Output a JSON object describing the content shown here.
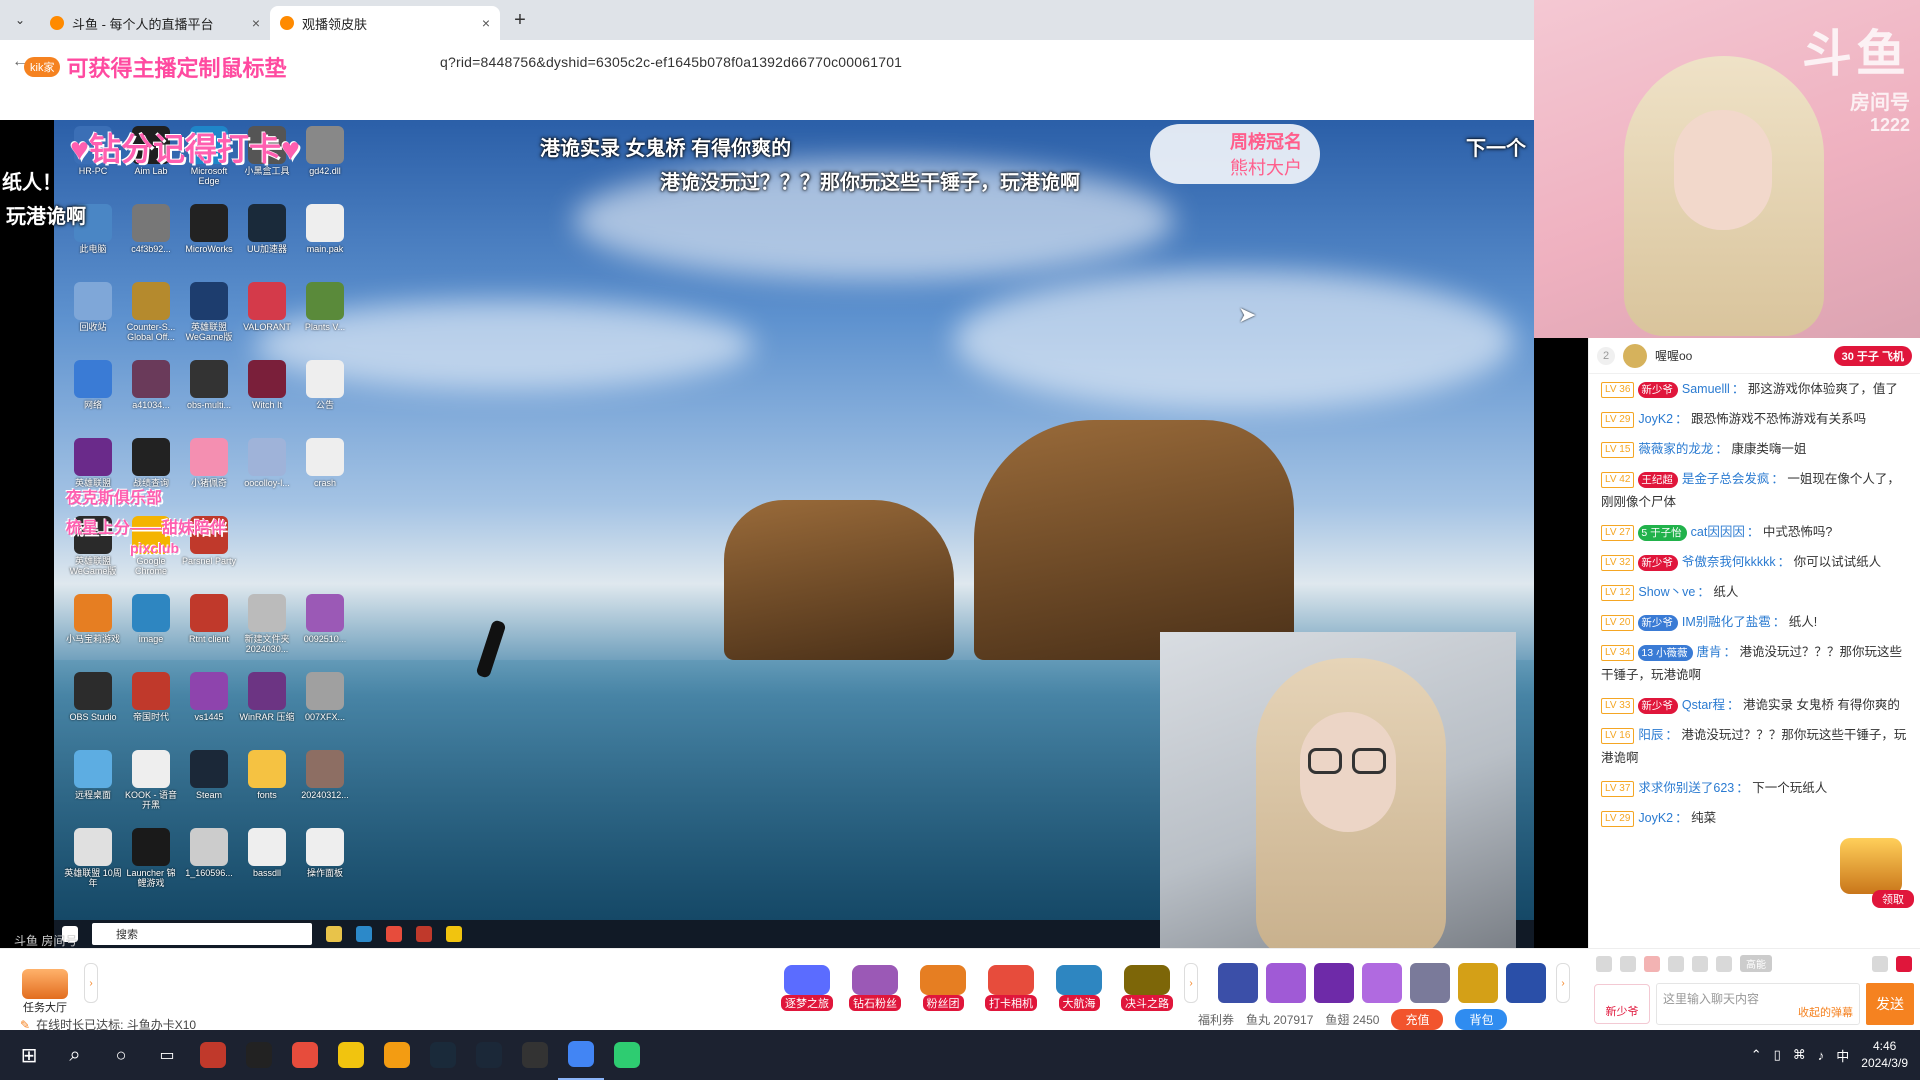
{
  "browser": {
    "tabs": [
      {
        "title": "斗鱼 - 每个人的直播平台",
        "active": false
      },
      {
        "title": "观播领皮肤",
        "active": true
      }
    ],
    "new_tab": "+",
    "close": "×",
    "url": "q?rid=8448756&dyshid=6305c2c-ef1645b078f0a1392d66770c00061701"
  },
  "promo": {
    "badge": "kik家",
    "text": "可获得主播定制鼠标垫"
  },
  "overlay": {
    "diamond_text": "♥钻分记得打卡♥",
    "line1": "港诡实录 女鬼桥 有得你爽的",
    "line2": "港诡没玩过？？？那你玩这些干锤子，玩港诡啊",
    "left_line1": "纸人！",
    "left_line2": "玩港诡啊",
    "right_cut": "下一个",
    "weekly_title": "周榜冠名",
    "weekly_name": "熊村大户",
    "club_text": "夜克斯俱乐部",
    "ranking_text": "梳星上分——甜妹陪伴",
    "pixclub": "pixclub",
    "watermark": "斗鱼 房间号",
    "search": "搜索"
  },
  "desktop_icons": [
    {
      "label": "HR-PC",
      "color": "#3b6fb6"
    },
    {
      "label": "Aim Lab",
      "color": "#1f1f1f"
    },
    {
      "label": "Microsoft Edge",
      "color": "#1f86c9"
    },
    {
      "label": "小黑盒工具",
      "color": "#555"
    },
    {
      "label": "gd42.dll",
      "color": "#888"
    },
    {
      "label": "此电脑",
      "color": "#4a86c5"
    },
    {
      "label": "c4f3b92...",
      "color": "#777"
    },
    {
      "label": "MicroWorks",
      "color": "#222"
    },
    {
      "label": "UU加速器",
      "color": "#1a2a3a"
    },
    {
      "label": "main.pak",
      "color": "#eee"
    },
    {
      "label": "回收站",
      "color": "#7fa7d8"
    },
    {
      "label": "Counter-S... Global Off...",
      "color": "#b58a2d"
    },
    {
      "label": "英雄联盟 WeGame版",
      "color": "#1d3d6e"
    },
    {
      "label": "VALORANT",
      "color": "#d43a4a"
    },
    {
      "label": "Plants V...",
      "color": "#5a8a3a"
    },
    {
      "label": "网络",
      "color": "#3a7bd5"
    },
    {
      "label": "a41034...",
      "color": "#6a3a5a"
    },
    {
      "label": "obs-multi...",
      "color": "#333"
    },
    {
      "label": "Witch It",
      "color": "#7a1f3a"
    },
    {
      "label": "公告",
      "color": "#eee"
    },
    {
      "label": "英雄联盟",
      "color": "#6a2a8a"
    },
    {
      "label": "战绩查询",
      "color": "#222"
    },
    {
      "label": "小猪佩奇",
      "color": "#f48fb1"
    },
    {
      "label": "oocolloy-l...",
      "color": "#9fb3d9"
    },
    {
      "label": "crash",
      "color": "#eee"
    },
    {
      "label": "英雄联盟 WeGame版",
      "color": "#2a2a2a"
    },
    {
      "label": "Google Chrome",
      "color": "#f4b400"
    },
    {
      "label": "Parsnel Party",
      "color": "#c0392b"
    },
    {
      "label": "",
      "color": "transparent"
    },
    {
      "label": "",
      "color": "transparent"
    },
    {
      "label": "小马宝莉游戏",
      "color": "#e67e22"
    },
    {
      "label": "image",
      "color": "#2e86c1"
    },
    {
      "label": "Rtnt client",
      "color": "#c0392b"
    },
    {
      "label": "新建文件夹 2024030...",
      "color": "#bbb"
    },
    {
      "label": "0092510...",
      "color": "#9b59b6"
    },
    {
      "label": "OBS Studio",
      "color": "#2c2c2c"
    },
    {
      "label": "帝国时代",
      "color": "#c0392b"
    },
    {
      "label": "vs1445",
      "color": "#8e44ad"
    },
    {
      "label": "WinRAR 压缩",
      "color": "#6c3483"
    },
    {
      "label": "007XFX...",
      "color": "#a0a0a0"
    },
    {
      "label": "远程桌面",
      "color": "#5dade2"
    },
    {
      "label": "KOOK - 语音开黑",
      "color": "#eee"
    },
    {
      "label": "Steam",
      "color": "#1b2838"
    },
    {
      "label": "fonts",
      "color": "#f5c242"
    },
    {
      "label": "20240312...",
      "color": "#8d6e63"
    },
    {
      "label": "英雄联盟 10周年",
      "color": "#e0e0e0"
    },
    {
      "label": "Launcher 锦鲤游戏",
      "color": "#1a1a1a"
    },
    {
      "label": "1_160596...",
      "color": "#ccc"
    },
    {
      "label": "bassdll",
      "color": "#eee"
    },
    {
      "label": "操作面板",
      "color": "#eee"
    }
  ],
  "right_cam": {
    "logo": "斗鱼",
    "room_label": "房间号",
    "room_no": "1222"
  },
  "chat": {
    "rank_no": "2",
    "top_user": "喔喔oo",
    "plane_badge": "30 于子 飞机",
    "messages": [
      {
        "lv": "LV 36",
        "badge": "新少爷",
        "badge_color": "#e0163b",
        "user": "Samuelll",
        "text": "那这游戏你体验爽了，值了"
      },
      {
        "lv": "LV 29",
        "badge": "",
        "badge_color": "",
        "user": "JoyK2",
        "text": "跟恐怖游戏不恐怖游戏有关系吗"
      },
      {
        "lv": "LV 15",
        "badge": "",
        "badge_color": "",
        "user": "薇薇家的龙龙",
        "text": "康康类嗨一姐"
      },
      {
        "lv": "LV 42",
        "badge": "王纪超",
        "badge_color": "#e0163b",
        "user": "是金子总会发疯",
        "text": "一姐现在像个人了，刚刚像个尸体"
      },
      {
        "lv": "LV 27",
        "badge": "5 于子怡",
        "badge_color": "#21b24b",
        "user": "cat因因因",
        "text": "中式恐怖吗?"
      },
      {
        "lv": "LV 32",
        "badge": "新少爷",
        "badge_color": "#e0163b",
        "user": "爷傲奈我何kkkkk",
        "text": "你可以试试纸人"
      },
      {
        "lv": "LV 12",
        "badge": "",
        "badge_color": "",
        "user": "Show丶ve",
        "text": "纸人"
      },
      {
        "lv": "LV 20",
        "badge": "新少爷",
        "badge_color": "#3a7bd5",
        "user": "IM别融化了盐雹",
        "text": "纸人!"
      },
      {
        "lv": "LV 34",
        "badge": "13 小薇薇",
        "badge_color": "#3a7bd5",
        "user": "唐肯",
        "text": "港诡没玩过？？？那你玩这些干锤子，玩港诡啊"
      },
      {
        "lv": "LV 33",
        "badge": "新少爷",
        "badge_color": "#e0163b",
        "user": "Qstar程",
        "text": "港诡实录 女鬼桥 有得你爽的"
      },
      {
        "lv": "LV 16",
        "badge": "",
        "badge_color": "",
        "user": "阳辰",
        "text": "港诡没玩过？？？那你玩这些干锤子，玩港诡啊"
      },
      {
        "lv": "LV 37",
        "badge": "",
        "badge_color": "",
        "user": "求求你别送了623",
        "text": "下一个玩纸人"
      },
      {
        "lv": "LV 29",
        "badge": "",
        "badge_color": "",
        "user": "JoyK2",
        "text": "纯菜"
      }
    ],
    "claim": "领取",
    "hd": "高能",
    "noble": "新少爷",
    "input_placeholder": "这里输入聊天内容",
    "collapse": "收起的弹幕",
    "send": "发送"
  },
  "giftbar": {
    "task_hall": "任务大厅",
    "features": [
      {
        "label": "逐梦之旅",
        "color": "#5b6cff"
      },
      {
        "label": "钻石粉丝",
        "color": "#9b59b6"
      },
      {
        "label": "粉丝团",
        "color": "#e67e22"
      },
      {
        "label": "打卡相机",
        "color": "#e74c3c"
      },
      {
        "label": "大航海",
        "color": "#2e86c1"
      },
      {
        "label": "决斗之路",
        "color": "#7d6608"
      }
    ],
    "gifts": [
      "#3b4fa8",
      "#a05ad6",
      "#6e2aa8",
      "#b06ae0",
      "#7a7a9a",
      "#d4a017",
      "#2a4fa8"
    ],
    "welfare": "福利券",
    "fishball": "鱼丸 207917",
    "fishfin": "鱼翅 2450",
    "recharge": "充值",
    "backpack": "背包",
    "online_label": "在线时长已达标: 斗鱼办卡X10"
  },
  "taskbar": {
    "start": "⊞",
    "apps": [
      "#c0392b",
      "#222",
      "#e74c3c",
      "#f1c40f",
      "#f39c12",
      "#1a2a3a",
      "#1b2838",
      "#333",
      "#4285f4",
      "#2ecc71"
    ],
    "lang": "中",
    "time": "4:46",
    "date": "2024/3/9"
  }
}
